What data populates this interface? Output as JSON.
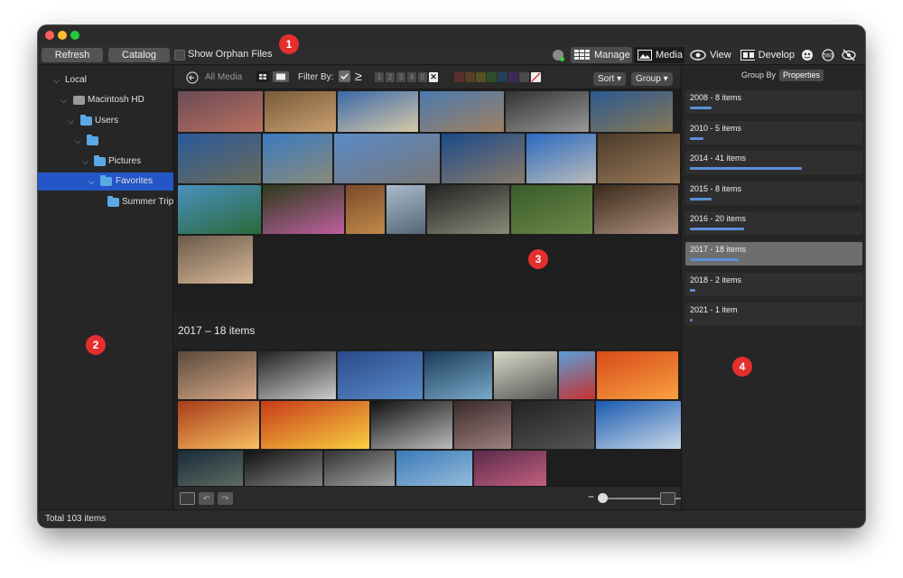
{
  "toolbar": {
    "refresh_label": "Refresh",
    "catalog_label": "Catalog",
    "orphan_label": "Show Orphan Files",
    "modes": [
      {
        "label": "Manage",
        "icon": "grid-icon"
      },
      {
        "label": "Media",
        "icon": "media-icon"
      },
      {
        "label": "View",
        "icon": "eye-icon"
      },
      {
        "label": "Develop",
        "icon": "develop-icon"
      }
    ]
  },
  "sidebar": {
    "items": [
      {
        "label": "Local"
      },
      {
        "label": "Macintosh HD"
      },
      {
        "label": "Users"
      },
      {
        "label": ""
      },
      {
        "label": "Pictures"
      },
      {
        "label": "Favorites"
      },
      {
        "label": "Summer Trip"
      }
    ]
  },
  "filterbar": {
    "all_media": "All Media",
    "filter_by": "Filter By:",
    "gte": "≥",
    "ratings": [
      "1",
      "2",
      "3",
      "4",
      "5"
    ],
    "reject": "✕",
    "sort": "Sort",
    "group": "Group",
    "label_colors": [
      "#5a2f2a",
      "#5a3f25",
      "#565024",
      "#2f4d2a",
      "#253f5a",
      "#3f2a55",
      "#4a4a4a"
    ]
  },
  "main": {
    "group_header": "2017 – 18 items"
  },
  "right_panel": {
    "group_by": "Group By",
    "properties": "Properties",
    "groups": [
      {
        "label": "2008 - 8 items",
        "count": 8
      },
      {
        "label": "2010 - 5 items",
        "count": 5
      },
      {
        "label": "2014 - 41 items",
        "count": 41
      },
      {
        "label": "2015 - 8 items",
        "count": 8
      },
      {
        "label": "2016 - 20 items",
        "count": 20
      },
      {
        "label": "2017 - 18 items",
        "count": 18
      },
      {
        "label": "2018 - 2 items",
        "count": 2
      },
      {
        "label": "2021 - 1 item",
        "count": 1
      }
    ]
  },
  "status": {
    "total": "Total 103 items"
  },
  "badges": [
    "1",
    "2",
    "3",
    "4"
  ],
  "colors": {
    "accent": "#2456c7",
    "badge": "#e52e2e",
    "group_bar": "#5c8fd6"
  }
}
